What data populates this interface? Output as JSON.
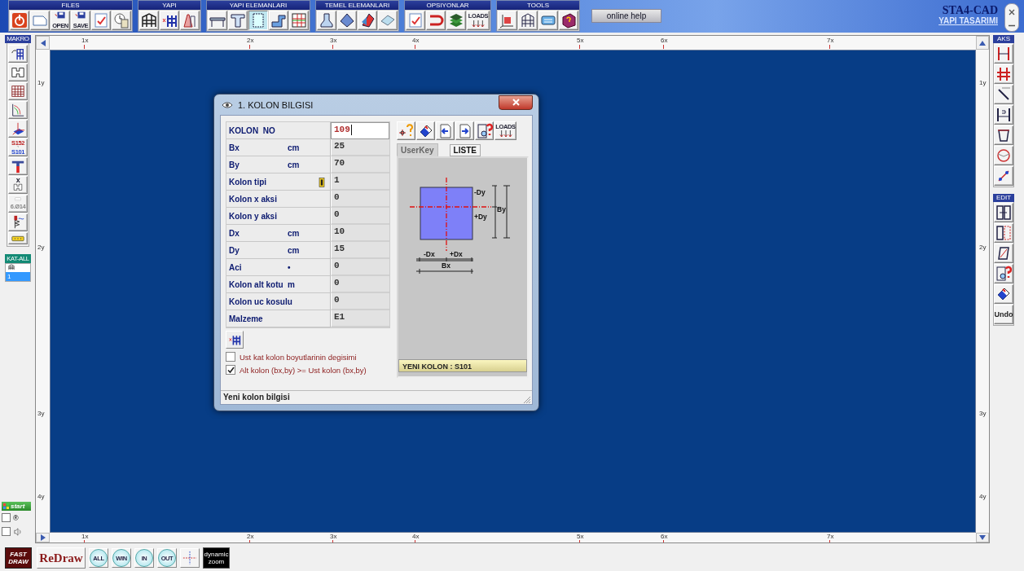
{
  "toolbar": {
    "groups": [
      {
        "title": "FILES",
        "tools": [
          {
            "kind": "power",
            "selected": false
          },
          {
            "kind": "page",
            "selected": false
          },
          {
            "kind": "disk",
            "caption": "OPEN",
            "selected": false
          },
          {
            "kind": "disk",
            "caption": "SAVE",
            "selected": false
          },
          {
            "kind": "checklist",
            "selected": false
          },
          {
            "kind": "clock",
            "selected": false
          }
        ]
      },
      {
        "title": "YAPI",
        "tools": [
          {
            "kind": "frame",
            "selected": false
          },
          {
            "kind": "columns",
            "selected": false
          },
          {
            "kind": "ramp",
            "selected": false
          }
        ]
      },
      {
        "title": "YAPI ELEMANLARI",
        "tools": [
          {
            "kind": "beam",
            "selected": false
          },
          {
            "kind": "tbeam",
            "selected": false
          },
          {
            "kind": "panel",
            "selected": true
          },
          {
            "kind": "stair",
            "selected": false
          },
          {
            "kind": "grid",
            "selected": false
          }
        ]
      },
      {
        "title": "TEMEL ELEMANLARI",
        "tools": [
          {
            "kind": "footing",
            "selected": false
          },
          {
            "kind": "pyramid",
            "selected": false
          },
          {
            "kind": "wallfooting",
            "selected": false
          },
          {
            "kind": "slab",
            "selected": false
          }
        ]
      },
      {
        "title": "OPSIYONLAR",
        "tools": [
          {
            "kind": "checklist",
            "selected": false
          },
          {
            "kind": "hook",
            "selected": false
          },
          {
            "kind": "books",
            "selected": false
          },
          {
            "kind": "loads",
            "caption": "LOADS",
            "selected": false
          }
        ]
      },
      {
        "title": "TOOLS",
        "tools": [
          {
            "kind": "axes",
            "selected": false
          },
          {
            "kind": "gridframe",
            "selected": false
          },
          {
            "kind": "keyboard",
            "selected": false
          },
          {
            "kind": "bookq",
            "selected": false
          }
        ]
      }
    ],
    "help_button": "online help",
    "app_title": "STA4-CAD",
    "app_link": "YAPI TASARIMI"
  },
  "left_panel": {
    "title": "MAKRO",
    "tools": [
      {
        "kind": "colrotate"
      },
      {
        "kind": "plan"
      },
      {
        "kind": "gridred"
      },
      {
        "kind": "chart"
      },
      {
        "kind": "axes3d"
      },
      {
        "kind": "rename",
        "captions": [
          "S152",
          "S101"
        ]
      },
      {
        "kind": "funnel"
      },
      {
        "kind": "planx",
        "captions": [
          "x"
        ]
      },
      {
        "kind": "rebar",
        "captions": [
          "6.Ø14"
        ]
      },
      {
        "kind": "spring"
      },
      {
        "kind": "ruler"
      }
    ],
    "floor_header": "KAT-ALL",
    "floors": [
      {
        "label": "1",
        "selected": true
      }
    ],
    "start": "start",
    "toggles": [
      {
        "kind": "record",
        "label": "®",
        "checked": false
      },
      {
        "kind": "sound",
        "checked": false
      }
    ]
  },
  "right_panel": {
    "sections": [
      {
        "title": "AKS",
        "tools": [
          {
            "kind": "axispair"
          },
          {
            "kind": "axisgrid"
          },
          {
            "kind": "diagonal"
          },
          {
            "kind": "dimension"
          },
          {
            "kind": "trapezoid"
          },
          {
            "kind": "circle"
          },
          {
            "kind": "diagonal2"
          }
        ]
      },
      {
        "title": "EDIT",
        "tools": [
          {
            "kind": "move"
          },
          {
            "kind": "copy"
          },
          {
            "kind": "parallelogram"
          },
          {
            "kind": "find"
          },
          {
            "kind": "eraser"
          },
          {
            "kind": "undo",
            "captions": [
              "Undo"
            ]
          }
        ]
      }
    ]
  },
  "canvas": {
    "top_ruler": [
      "1x",
      "2x",
      "3x",
      "4x",
      "5x",
      "6x",
      "7x"
    ],
    "bottom_ruler": [
      "1x",
      "2x",
      "3x",
      "4x",
      "5x",
      "6x",
      "7x"
    ],
    "left_ruler": [
      "1y",
      "2y",
      "3y",
      "4y"
    ],
    "right_ruler": [
      "1y",
      "2y",
      "3y",
      "4y"
    ]
  },
  "dialog": {
    "title": "1. KOLON BILGISI",
    "rows": [
      {
        "kind": "input",
        "label": "KOLON  NO",
        "value": "109"
      },
      {
        "kind": "readout",
        "label": "Bx",
        "unit": "cm",
        "value": "25"
      },
      {
        "kind": "readout",
        "label": "By",
        "unit": "cm",
        "value": "70"
      },
      {
        "kind": "readout",
        "label": "Kolon tipi",
        "value": "1",
        "has_picker": true
      },
      {
        "kind": "readout",
        "label": "Kolon x aksi",
        "value": "0"
      },
      {
        "kind": "readout",
        "label": "Kolon y aksi",
        "value": "0"
      },
      {
        "kind": "readout",
        "label": "Dx",
        "unit": "cm",
        "value": "10"
      },
      {
        "kind": "readout",
        "label": "Dy",
        "unit": "cm",
        "value": "15"
      },
      {
        "kind": "readout",
        "label": "Aci",
        "unit": "•",
        "value": "0"
      },
      {
        "kind": "readout",
        "label": "Kolon alt kotu",
        "unit": "m",
        "value": "0"
      },
      {
        "kind": "readout",
        "label": "Kolon uc kosulu",
        "value": "0"
      },
      {
        "kind": "readout",
        "label": "Malzeme",
        "value": "E1"
      }
    ],
    "tools": [
      {
        "kind": "coordq"
      },
      {
        "kind": "eraser"
      },
      {
        "kind": "pageleft"
      },
      {
        "kind": "pageright"
      },
      {
        "kind": "find"
      },
      {
        "kind": "loads",
        "caption": "LOADS"
      }
    ],
    "tabs": [
      {
        "label": "UserKey",
        "selected": true
      },
      {
        "label": "LISTE",
        "selected": false
      }
    ],
    "diagram_labels": {
      "minus_dy": "-Dy",
      "plus_dy": "+Dy",
      "by": "By",
      "minus_dx": "-Dx",
      "plus_dx": "+Dx",
      "bx": "Bx"
    },
    "new_column": "YENI KOLON : S101",
    "options": [
      {
        "label": "Ust kat kolon boyutlarinin  degisimi",
        "checked": false
      },
      {
        "label": "Alt kolon (bx,by) >= Ust kolon (bx,by)",
        "checked": true
      }
    ],
    "status": "Yeni kolon bilgisi"
  },
  "bottom_bar": {
    "buttons": [
      {
        "kind": "fast",
        "caption": "FAST DRAW"
      },
      {
        "kind": "redraw",
        "caption": "ReDraw"
      },
      {
        "kind": "zoom",
        "caption": "ALL"
      },
      {
        "kind": "zoom",
        "caption": "WIN"
      },
      {
        "kind": "zoom",
        "caption": "IN"
      },
      {
        "kind": "zoom",
        "caption": "OUT"
      },
      {
        "kind": "crosshair"
      },
      {
        "kind": "dynamic",
        "caption": "dynamic zoom"
      }
    ]
  }
}
